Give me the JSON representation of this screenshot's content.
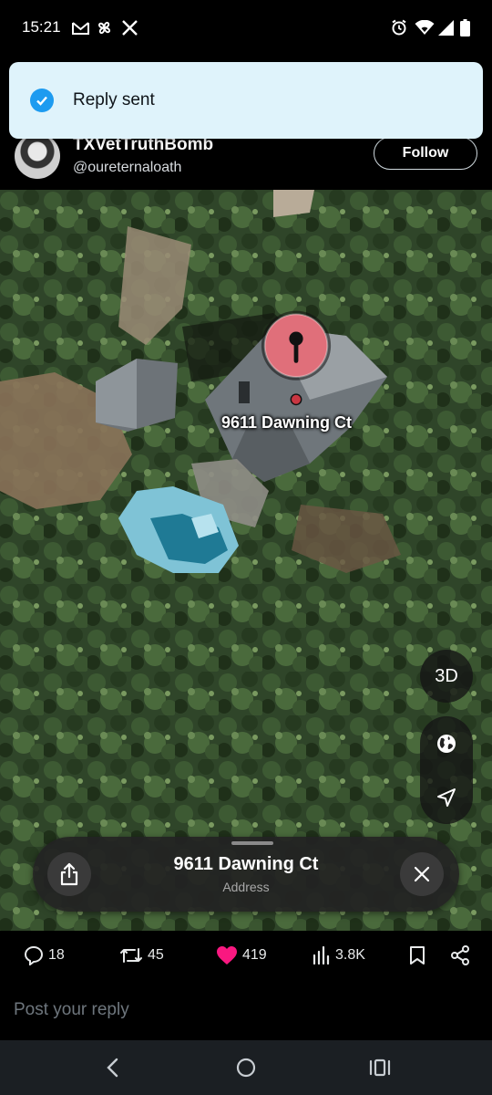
{
  "status_bar": {
    "time": "15:21",
    "left_icons": [
      "gmail-icon",
      "pinwheel-icon",
      "x-logo-icon"
    ],
    "right_icons": [
      "alarm-icon",
      "wifi-icon",
      "signal-icon",
      "battery-icon"
    ]
  },
  "toast": {
    "text": "Reply sent",
    "icon": "check-circle-icon",
    "accent": "#1d9bf0"
  },
  "post_header": {
    "display_name": "TXVetTruthBomb",
    "handle": "@oureternaloath",
    "follow_label": "Follow"
  },
  "map": {
    "pin_label": "9611 Dawning Ct",
    "pin_color": "#e06f7a",
    "button_3d": "3D",
    "buttons": [
      "globe-icon",
      "location-arrow-icon"
    ],
    "card": {
      "title": "9611 Dawning Ct",
      "subtitle": "Address",
      "share_icon": "share-icon",
      "close_icon": "close-icon"
    }
  },
  "actions": {
    "replies": "18",
    "reposts": "45",
    "likes": "419",
    "views": "3.8K",
    "like_color": "#f91880"
  },
  "reply": {
    "placeholder": "Post your reply"
  },
  "nav": [
    "back-icon",
    "home-icon",
    "recents-icon"
  ]
}
